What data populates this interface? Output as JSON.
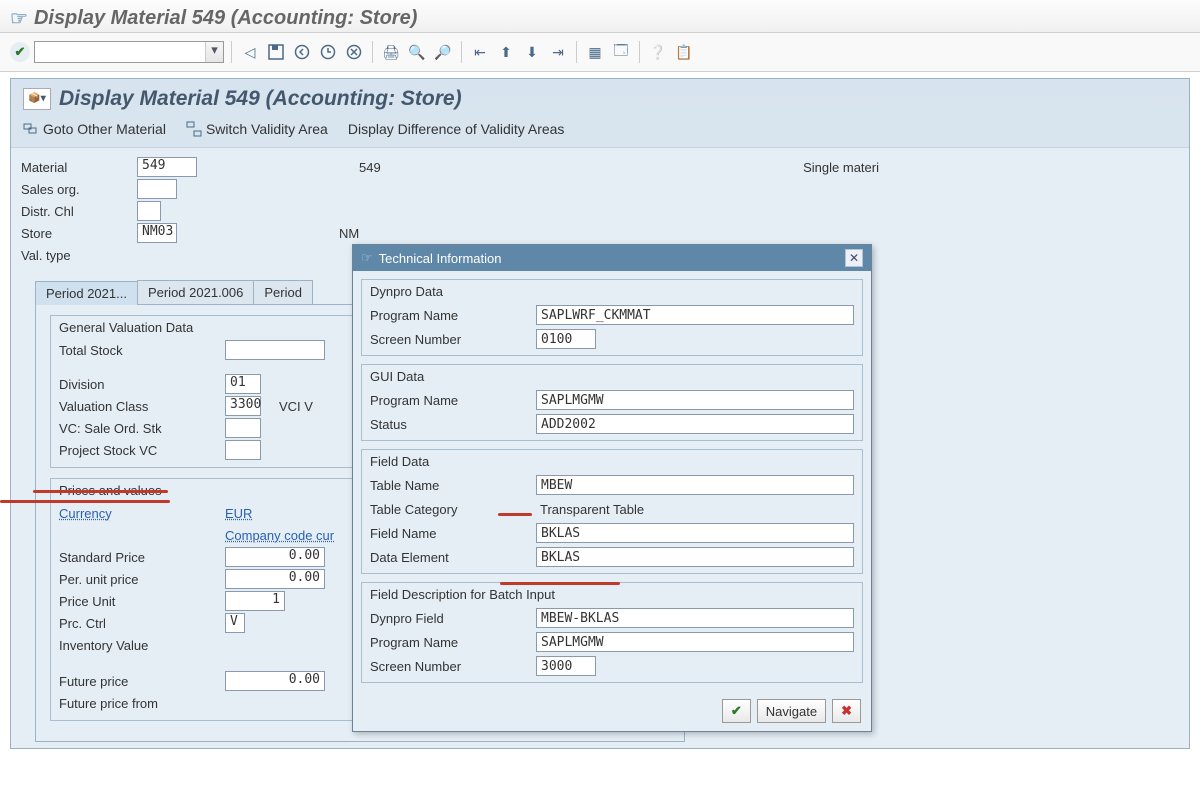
{
  "window": {
    "title": "Display Material 549 (Accounting: Store)"
  },
  "screen": {
    "title": "Display Material 549 (Accounting: Store)"
  },
  "subtoolbar": {
    "goto_other": "Goto Other Material",
    "switch_validity": "Switch Validity Area",
    "display_diff": "Display Difference of Validity Areas"
  },
  "header": {
    "labels": {
      "material": "Material",
      "sales_org": "Sales org.",
      "distr_chl": "Distr. Chl",
      "store": "Store",
      "val_type": "Val. type"
    },
    "material": "549",
    "material_desc": "549",
    "sales_org": "",
    "distr_chl": "",
    "store": "NM03",
    "store_desc": "NM",
    "val_type": "",
    "single_material": "Single materi"
  },
  "tabs": {
    "t1": "Period 2021...",
    "t2": "Period 2021.006",
    "t3": "Period "
  },
  "valuation": {
    "legend": "General Valuation Data",
    "total_stock_lbl": "Total Stock",
    "total_stock": "",
    "division_lbl": "Division",
    "division": "01",
    "valuation_class_lbl": "Valuation Class",
    "valuation_class": "3300",
    "vci_v": "VCI V",
    "vc_sale_ord_lbl": "VC: Sale Ord. Stk",
    "project_stock_vc_lbl": "Project Stock VC"
  },
  "prices": {
    "legend": "Prices and values",
    "currency_lbl": "Currency",
    "currency": "EUR",
    "cc_curr_lbl": "Company code cur",
    "std_price_lbl": "Standard Price",
    "std_price": "0.00",
    "per_unit_lbl": "Per. unit price",
    "per_unit": "0.00",
    "price_unit_lbl": "Price Unit",
    "price_unit": "1",
    "prc_ctrl_lbl": "Prc. Ctrl",
    "prc_ctrl": "V",
    "inv_value_lbl": "Inventory Value",
    "future_price_lbl": "Future price",
    "future_price": "0.00",
    "future_price_from_lbl": "Future price from"
  },
  "popup": {
    "title": "Technical Information",
    "close": "✕",
    "dynpro": {
      "legend": "Dynpro Data",
      "program_lbl": "Program Name",
      "program": "SAPLWRF_CKMMAT",
      "screen_lbl": "Screen Number",
      "screen": "0100"
    },
    "gui": {
      "legend": "GUI Data",
      "program_lbl": "Program Name",
      "program": "SAPLMGMW",
      "status_lbl": "Status",
      "status": "ADD2002"
    },
    "field": {
      "legend": "Field Data",
      "table_lbl": "Table Name",
      "table": "MBEW",
      "tabcat_lbl": "Table Category",
      "tabcat": "Transparent Table",
      "fieldname_lbl": "Field Name",
      "fieldname": "BKLAS",
      "dataelem_lbl": "Data Element",
      "dataelem": "BKLAS"
    },
    "batch": {
      "legend": "Field Description for Batch Input",
      "dynfield_lbl": "Dynpro Field",
      "dynfield": "MBEW-BKLAS",
      "program_lbl": "Program Name",
      "program": "SAPLMGMW",
      "screen_lbl": "Screen Number",
      "screen": "3000"
    },
    "foot": {
      "ok": "✔",
      "nav": "Navigate",
      "cancel": "✖"
    }
  }
}
